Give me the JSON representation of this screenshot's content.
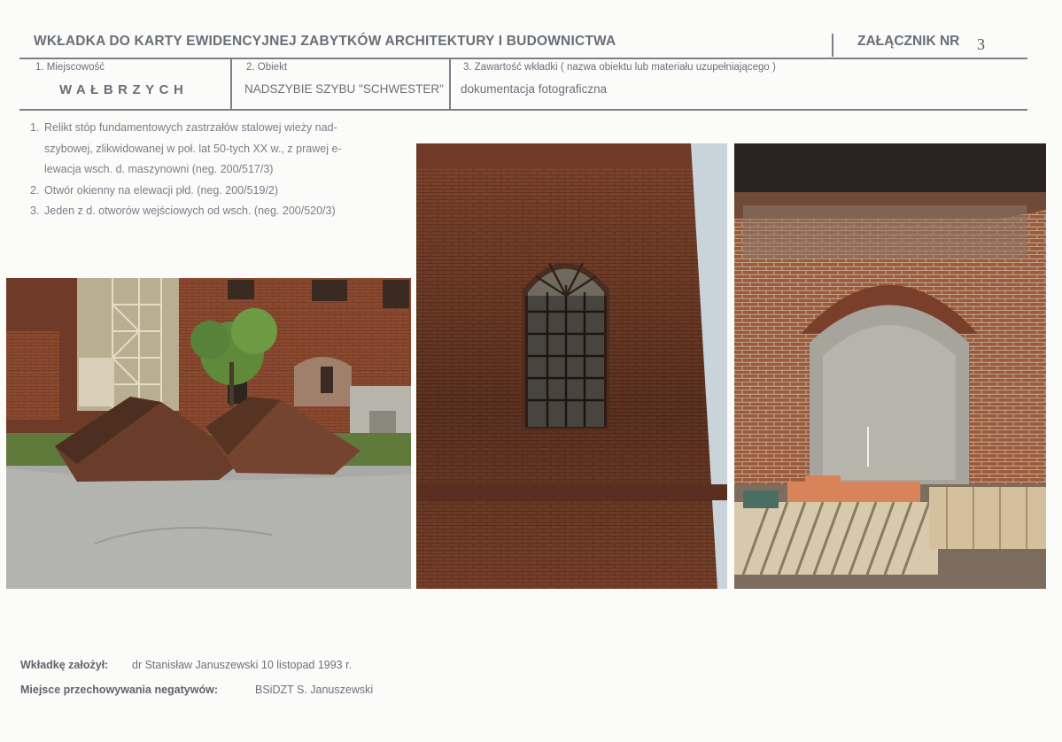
{
  "header": {
    "title": "WKŁADKA DO KARTY EWIDENCYJNEJ ZABYTKÓW ARCHITEKTURY I BUDOWNICTWA",
    "attachment_label": "ZAŁĄCZNIK NR",
    "attachment_number": "3"
  },
  "fields": {
    "locality_label": "1. Miejscowość",
    "locality_value": "WAŁBRZYCH",
    "object_label": "2. Obiekt",
    "object_value": "NADSZYBIE SZYBU \"SCHWESTER\"",
    "content_label": "3. Zawartość wkładki ( nazwa obiektu lub materiału uzupełniającego )",
    "content_value": "dokumentacja fotograficzna"
  },
  "descriptions": [
    {
      "number": "1.",
      "lines": [
        "Relikt stóp fundamentowych zastrzałów stalowej wieży nad-",
        "szybowej, zlikwidowanej w poł. lat 50-tych XX w., z prawej e-",
        "lewacja wsch. d. maszynowni (neg. 200/517/3)"
      ]
    },
    {
      "number": "2.",
      "lines": [
        "Otwór okienny na elewacji płd. (neg. 200/519/2)"
      ]
    },
    {
      "number": "3.",
      "lines": [
        "Jeden z d. otworów wejściowych od wsch. (neg. 200/520/3)"
      ]
    }
  ],
  "footer": {
    "founder_label": "Wkładkę założył:",
    "founder_value": "dr Stanisław Januszewski 10 listopad 1993 r.",
    "storage_label": "Miejsce przechowywania negatywów:",
    "storage_value": "BSiDZT S. Januszewski"
  },
  "colors": {
    "brick": "#8a4e34",
    "brick_dark": "#5e3422",
    "rule": "#7a7f88"
  }
}
